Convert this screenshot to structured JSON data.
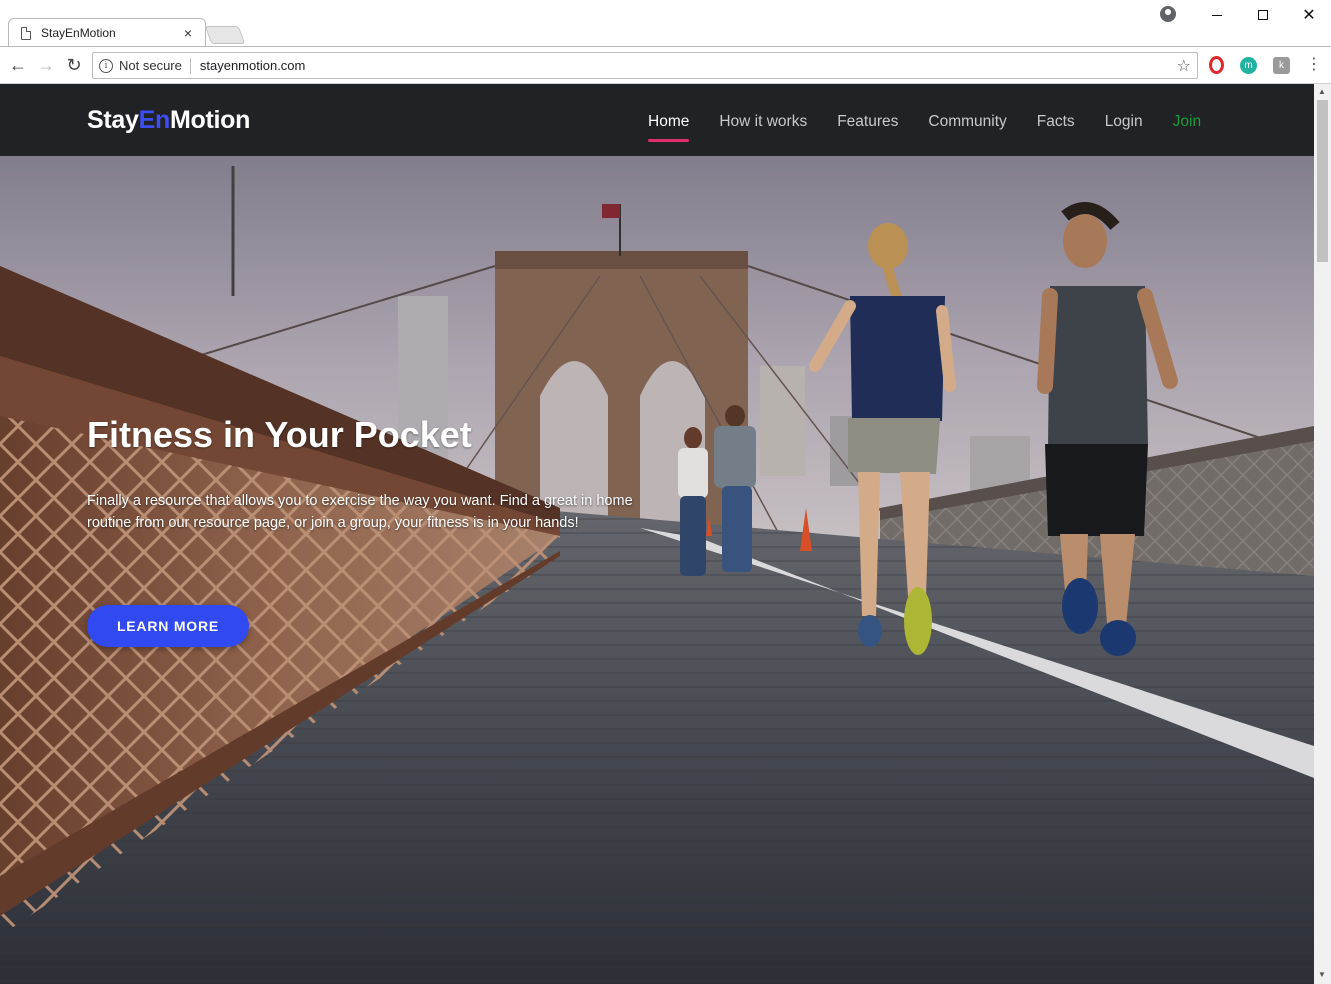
{
  "browser": {
    "tab_title": "StayEnMotion",
    "tab_close": "×",
    "security_label": "Not secure",
    "url": "stayenmotion.com",
    "ext_m": "m",
    "ext_k": "k"
  },
  "site": {
    "logo_part1": "Stay",
    "logo_part2": "En",
    "logo_part3": "Motion",
    "nav": [
      {
        "label": "Home",
        "active": true
      },
      {
        "label": "How it works"
      },
      {
        "label": "Features"
      },
      {
        "label": "Community"
      },
      {
        "label": "Facts"
      },
      {
        "label": "Login"
      },
      {
        "label": "Join"
      }
    ],
    "colors": {
      "accent": "#3049f0",
      "nav_bg": "#212226",
      "active_underline": "#e02d6b",
      "join": "#1f9a3d"
    }
  },
  "hero": {
    "title": "Fitness in Your Pocket",
    "text": "Finally a resource that allows you to exercise the way you want. Find a great in home routine from our resource page, or join a group, your fitness is in your hands!",
    "button_label": "LEARN MORE"
  }
}
